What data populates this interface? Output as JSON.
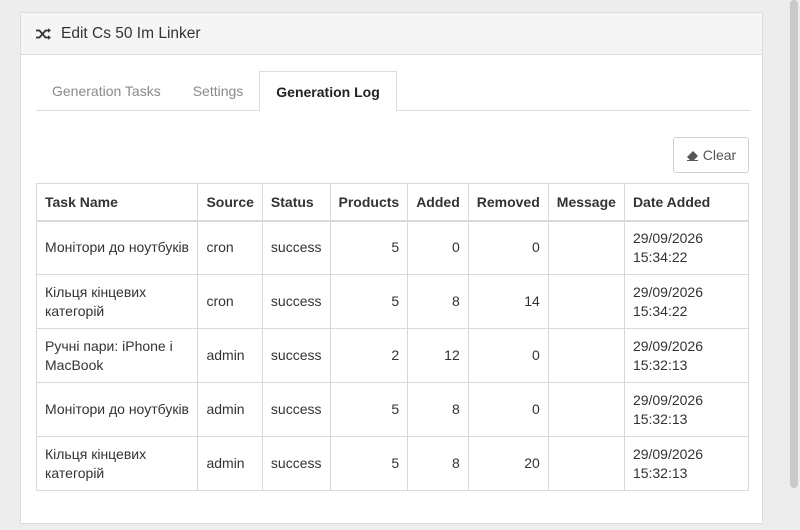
{
  "panel": {
    "title": "Edit Cs 50 Im Linker",
    "title_icon": "shuffle-icon"
  },
  "tabs": [
    {
      "label": "Generation Tasks",
      "active": false
    },
    {
      "label": "Settings",
      "active": false
    },
    {
      "label": "Generation Log",
      "active": true
    }
  ],
  "toolbar": {
    "clear_label": "Clear",
    "clear_icon": "eraser-icon"
  },
  "table": {
    "headers": [
      "Task Name",
      "Source",
      "Status",
      "Products",
      "Added",
      "Removed",
      "Message",
      "Date Added"
    ],
    "rows": [
      {
        "task": "Монітори до ноутбуків",
        "source": "cron",
        "status": "success",
        "products": "5",
        "added": "0",
        "removed": "0",
        "message": "",
        "date": "29/09/2026 15:34:22"
      },
      {
        "task": "Кільця кінцевих категорій",
        "source": "cron",
        "status": "success",
        "products": "5",
        "added": "8",
        "removed": "14",
        "message": "",
        "date": "29/09/2026 15:34:22"
      },
      {
        "task": "Ручні пари: iPhone і MacBook",
        "source": "admin",
        "status": "success",
        "products": "2",
        "added": "12",
        "removed": "0",
        "message": "",
        "date": "29/09/2026 15:32:13"
      },
      {
        "task": "Монітори до ноутбуків",
        "source": "admin",
        "status": "success",
        "products": "5",
        "added": "8",
        "removed": "0",
        "message": "",
        "date": "29/09/2026 15:32:13"
      },
      {
        "task": "Кільця кінцевих категорій",
        "source": "admin",
        "status": "success",
        "products": "5",
        "added": "8",
        "removed": "20",
        "message": "",
        "date": "29/09/2026 15:32:13"
      }
    ]
  },
  "colors": {
    "accent_text": "#333333",
    "muted_tab": "#8a8a8a",
    "border": "#d9d9d9"
  }
}
